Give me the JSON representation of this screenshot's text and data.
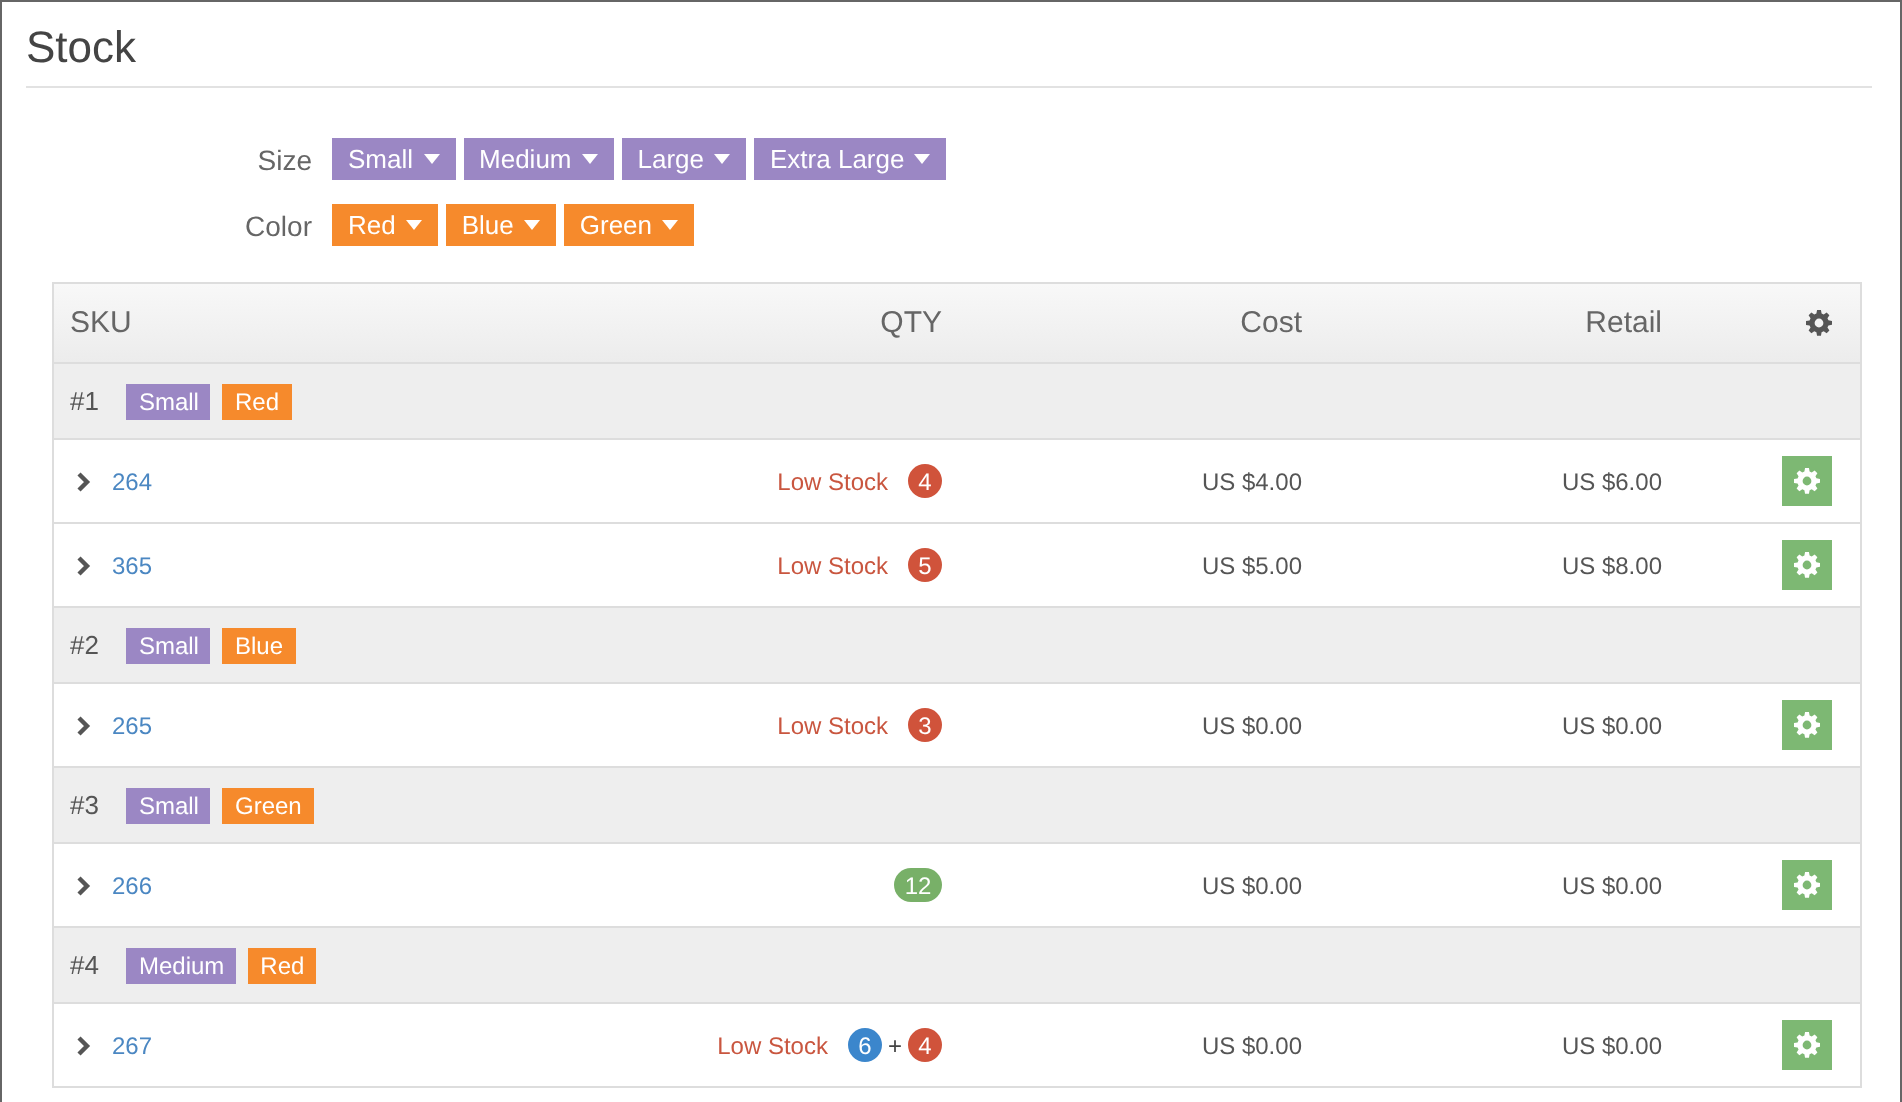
{
  "title": "Stock",
  "filters": [
    {
      "label": "Size",
      "options": [
        {
          "text": "Small",
          "color": "#9b87c4"
        },
        {
          "text": "Medium",
          "color": "#9b87c4"
        },
        {
          "text": "Large",
          "color": "#9b87c4"
        },
        {
          "text": "Extra Large",
          "color": "#9b87c4"
        }
      ]
    },
    {
      "label": "Color",
      "options": [
        {
          "text": "Red",
          "color": "#f68a2c"
        },
        {
          "text": "Blue",
          "color": "#f68a2c"
        },
        {
          "text": "Green",
          "color": "#f68a2c"
        }
      ]
    }
  ],
  "table": {
    "columns": [
      "SKU",
      "QTY",
      "Cost",
      "Retail"
    ],
    "groups": [
      {
        "label": "#1",
        "tags": [
          {
            "text": "Small",
            "color": "#9b87c4"
          },
          {
            "text": "Red",
            "color": "#f68a2c"
          }
        ],
        "rows": [
          {
            "sku": "264",
            "status": "Low Stock",
            "qty": [
              {
                "kind": "badge",
                "text": "4",
                "color": "#d0533b"
              }
            ],
            "cost": "US $4.00",
            "retail": "US $6.00"
          },
          {
            "sku": "365",
            "status": "Low Stock",
            "qty": [
              {
                "kind": "badge",
                "text": "5",
                "color": "#d0533b"
              }
            ],
            "cost": "US $5.00",
            "retail": "US $8.00"
          }
        ]
      },
      {
        "label": "#2",
        "tags": [
          {
            "text": "Small",
            "color": "#9b87c4"
          },
          {
            "text": "Blue",
            "color": "#f68a2c"
          }
        ],
        "rows": [
          {
            "sku": "265",
            "status": "Low Stock",
            "qty": [
              {
                "kind": "badge",
                "text": "3",
                "color": "#d0533b"
              }
            ],
            "cost": "US $0.00",
            "retail": "US $0.00"
          }
        ]
      },
      {
        "label": "#3",
        "tags": [
          {
            "text": "Small",
            "color": "#9b87c4"
          },
          {
            "text": "Green",
            "color": "#f68a2c"
          }
        ],
        "rows": [
          {
            "sku": "266",
            "qty": [
              {
                "kind": "badge",
                "text": "12",
                "color": "#78b068"
              }
            ],
            "cost": "US $0.00",
            "retail": "US $0.00"
          }
        ]
      },
      {
        "label": "#4",
        "tags": [
          {
            "text": "Medium",
            "color": "#9b87c4"
          },
          {
            "text": "Red",
            "color": "#f68a2c"
          }
        ],
        "rows": [
          {
            "sku": "267",
            "status": "Low Stock",
            "qty": [
              {
                "kind": "badge",
                "text": "6",
                "color": "#3b86cc"
              },
              {
                "kind": "plus",
                "text": "+"
              },
              {
                "kind": "badge",
                "text": "4",
                "color": "#d0533b"
              }
            ],
            "cost": "US $0.00",
            "retail": "US $0.00"
          }
        ]
      }
    ]
  }
}
